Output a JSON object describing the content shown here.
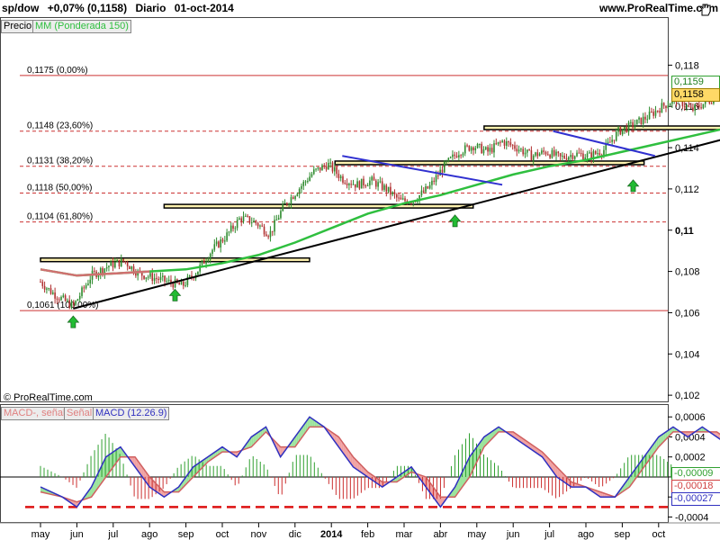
{
  "header": {
    "ticker": "sp/dow",
    "change": "+0,07% (0,1158)",
    "period": "Diario",
    "date": "01-oct-2014",
    "site": "www.ProRealTime.com"
  },
  "price_panel": {
    "tab_label": "Precio",
    "ma_label": "MM (Ponderada 150)",
    "copyright": "© ProRealTime.com",
    "last_price": "0,1158",
    "ma_value": "0,1159"
  },
  "macd_panel": {
    "legend": [
      {
        "text": "MACD-, señal",
        "color": "#e08080"
      },
      {
        "text": "Señal",
        "color": "#e08080"
      },
      {
        "text": "MACD (12.26.9)",
        "color": "#3030c0"
      }
    ],
    "readouts": [
      {
        "text": "-0,00009",
        "color": "#30a030"
      },
      {
        "text": "-0,00018",
        "color": "#d04040"
      },
      {
        "text": "-0,00027",
        "color": "#3030c0"
      }
    ]
  },
  "colors": {
    "up_candle": "#2e8b2e",
    "down_candle": "#b03030",
    "moving_average": "#2fbf3f",
    "trendline": "#000000",
    "channel_line": "#3030d0",
    "fib_line": "#cc3333",
    "zone_fill": "#fff3b0",
    "arrow": "#22bb33"
  },
  "icons": [
    "up-arrow-icon",
    "hand-icon"
  ],
  "chart_data": [
    {
      "type": "line",
      "series": [],
      "x_ticks": [
        "may",
        "jun",
        "jul",
        "ago",
        "sep",
        "oct",
        "nov",
        "dic",
        "2014",
        "feb",
        "mar",
        "abr",
        "may",
        "jun",
        "jul",
        "ago",
        "sep",
        "oct"
      ],
      "y_ticks": [
        "0,102",
        "0,104",
        "0,106",
        "0,108",
        "0,11",
        "0,112",
        "0,114",
        "0,116",
        "0,118"
      ],
      "ylim": [
        0.1017,
        0.1195
      ],
      "fibonacci_levels": [
        {
          "label": "0,1175 (0,00%)",
          "value": 0.1175,
          "style": "solid"
        },
        {
          "label": "0,1148 (23,60%)",
          "value": 0.1148,
          "style": "dashed"
        },
        {
          "label": "0,1131 (38,20%)",
          "value": 0.1131,
          "style": "dashed"
        },
        {
          "label": "0,1118 (50,00%)",
          "value": 0.1118,
          "style": "dashed"
        },
        {
          "label": "0,1104 (61,80%)",
          "value": 0.1104,
          "style": "dashed"
        },
        {
          "label": "0,1061 (100,00%)",
          "value": 0.1061,
          "style": "solid"
        }
      ],
      "price_path": [
        [
          0,
          0.1075
        ],
        [
          0.3,
          0.107
        ],
        [
          0.9,
          0.1063
        ],
        [
          1.4,
          0.1078
        ],
        [
          1.9,
          0.1083
        ],
        [
          2.3,
          0.1085
        ],
        [
          2.7,
          0.1079
        ],
        [
          3.1,
          0.1077
        ],
        [
          3.5,
          0.1075
        ],
        [
          3.9,
          0.1073
        ],
        [
          4.3,
          0.108
        ],
        [
          4.7,
          0.109
        ],
        [
          5.1,
          0.1097
        ],
        [
          5.5,
          0.1106
        ],
        [
          5.9,
          0.1104
        ],
        [
          6.3,
          0.1098
        ],
        [
          6.7,
          0.1112
        ],
        [
          7.1,
          0.112
        ],
        [
          7.5,
          0.1128
        ],
        [
          7.9,
          0.1132
        ],
        [
          8.3,
          0.1125
        ],
        [
          8.7,
          0.1122
        ],
        [
          9.1,
          0.1124
        ],
        [
          9.5,
          0.112
        ],
        [
          9.9,
          0.1114
        ],
        [
          10.3,
          0.1115
        ],
        [
          10.7,
          0.1121
        ],
        [
          11.1,
          0.1131
        ],
        [
          11.5,
          0.1138
        ],
        [
          11.9,
          0.1141
        ],
        [
          12.3,
          0.1138
        ],
        [
          12.7,
          0.1143
        ],
        [
          13.1,
          0.114
        ],
        [
          13.5,
          0.1136
        ],
        [
          13.9,
          0.1138
        ],
        [
          14.3,
          0.1135
        ],
        [
          14.7,
          0.1137
        ],
        [
          15.1,
          0.1136
        ],
        [
          15.5,
          0.1139
        ],
        [
          15.9,
          0.1148
        ],
        [
          16.3,
          0.1151
        ],
        [
          16.7,
          0.1155
        ],
        [
          17.1,
          0.116
        ],
        [
          17.5,
          0.1164
        ],
        [
          17.9,
          0.1158
        ],
        [
          18.3,
          0.1162
        ],
        [
          18.7,
          0.1166
        ],
        [
          19.1,
          0.117
        ],
        [
          19.5,
          0.1174
        ],
        [
          19.9,
          0.1168
        ],
        [
          20.3,
          0.1171
        ],
        [
          20.7,
          0.1176
        ],
        [
          21.1,
          0.1169
        ],
        [
          21.5,
          0.1172
        ],
        [
          21.9,
          0.1166
        ],
        [
          22.3,
          0.1162
        ],
        [
          22.5,
          0.1158
        ]
      ],
      "moving_average": [
        [
          0,
          0.1081
        ],
        [
          1,
          0.1078
        ],
        [
          2,
          0.1079
        ],
        [
          3,
          0.108
        ],
        [
          4,
          0.1081
        ],
        [
          5,
          0.1084
        ],
        [
          6,
          0.1088
        ],
        [
          7,
          0.1094
        ],
        [
          8,
          0.1101
        ],
        [
          9,
          0.1108
        ],
        [
          10,
          0.1113
        ],
        [
          11,
          0.1117
        ],
        [
          12,
          0.1122
        ],
        [
          13,
          0.1127
        ],
        [
          14,
          0.1131
        ],
        [
          15,
          0.1134
        ],
        [
          16,
          0.1138
        ],
        [
          17,
          0.1142
        ],
        [
          18,
          0.1146
        ],
        [
          19,
          0.115
        ],
        [
          20,
          0.1153
        ],
        [
          21,
          0.1157
        ],
        [
          22,
          0.116
        ],
        [
          22.5,
          0.1159
        ]
      ],
      "trendline": [
        [
          0.9,
          0.1062
        ],
        [
          22.9,
          0.1163
        ]
      ],
      "channel_lines": [
        [
          [
            8.3,
            0.1136
          ],
          [
            12.7,
            0.1122
          ]
        ],
        [
          [
            14.1,
            0.1148
          ],
          [
            16.9,
            0.1136
          ]
        ]
      ],
      "zones": [
        {
          "x0": 0,
          "x1": 7.4,
          "y_top": 0.10865,
          "y_bottom": 0.1085
        },
        {
          "x0": 3.4,
          "x1": 11.9,
          "y_top": 0.11125,
          "y_bottom": 0.1111
        },
        {
          "x0": 8.1,
          "x1": 16.6,
          "y_top": 0.11335,
          "y_bottom": 0.1132
        },
        {
          "x0": 12.2,
          "x1": 20.6,
          "y_top": 0.11505,
          "y_bottom": 0.1149
        }
      ],
      "buy_arrows": [
        [
          0.9,
          0.1061
        ],
        [
          3.7,
          0.1074
        ],
        [
          11.4,
          0.111
        ],
        [
          16.3,
          0.1127
        ],
        [
          21.8,
          0.1152
        ]
      ]
    },
    {
      "type": "line",
      "x_ticks": [
        "may",
        "jun",
        "jul",
        "ago",
        "sep",
        "oct",
        "nov",
        "dic",
        "2014",
        "feb",
        "mar",
        "abr",
        "may",
        "jun",
        "jul",
        "ago",
        "sep",
        "oct"
      ],
      "y_ticks": [
        "0,0006",
        "0,0004",
        "0,0002",
        "0",
        "-0,0002",
        "-0,0004"
      ],
      "ylim": [
        -0.00045,
        0.00071
      ],
      "support_level": -0.0003,
      "series": [
        {
          "name": "MACD",
          "values": [
            [
              0,
              -0.0001
            ],
            [
              0.6,
              -0.0002
            ],
            [
              1,
              -0.0003
            ],
            [
              1.4,
              -0.0001
            ],
            [
              1.8,
              0.0002
            ],
            [
              2.2,
              0.0003
            ],
            [
              2.6,
              0.0001
            ],
            [
              3,
              -0.0001
            ],
            [
              3.4,
              -0.0002
            ],
            [
              3.8,
              -0.0001
            ],
            [
              4.2,
              0.0001
            ],
            [
              4.6,
              0.0002
            ],
            [
              5,
              0.0003
            ],
            [
              5.4,
              0.0002
            ],
            [
              5.8,
              0.0004
            ],
            [
              6.2,
              0.0005
            ],
            [
              6.6,
              0.0002
            ],
            [
              7,
              0.0004
            ],
            [
              7.4,
              0.0006
            ],
            [
              7.8,
              0.0005
            ],
            [
              8.2,
              0.0003
            ],
            [
              8.6,
              0.0001
            ],
            [
              9,
              0
            ],
            [
              9.4,
              -0.0001
            ],
            [
              9.8,
              0
            ],
            [
              10.2,
              0.0001
            ],
            [
              10.6,
              -0.0001
            ],
            [
              11,
              -0.0003
            ],
            [
              11.4,
              -0.0001
            ],
            [
              11.8,
              0.0002
            ],
            [
              12.2,
              0.0004
            ],
            [
              12.6,
              0.0005
            ],
            [
              13,
              0.0004
            ],
            [
              13.4,
              0.0003
            ],
            [
              13.8,
              0.0002
            ],
            [
              14.2,
              0
            ],
            [
              14.6,
              -0.0001
            ],
            [
              15,
              -0.0001
            ],
            [
              15.4,
              -0.0002
            ],
            [
              15.8,
              -0.0002
            ],
            [
              16.2,
              0
            ],
            [
              16.6,
              0.0002
            ],
            [
              17,
              0.0004
            ],
            [
              17.4,
              0.0005
            ],
            [
              17.8,
              0.0004
            ],
            [
              18.2,
              0.0005
            ],
            [
              18.6,
              0.0004
            ],
            [
              19,
              0.0003
            ],
            [
              19.4,
              0.0001
            ],
            [
              19.8,
              0.0001
            ],
            [
              20.2,
              0
            ],
            [
              20.6,
              -0.0001
            ],
            [
              21,
              -0.0001
            ],
            [
              21.4,
              -0.0001
            ],
            [
              21.8,
              -0.0002
            ],
            [
              22.3,
              -0.00027
            ]
          ]
        },
        {
          "name": "Señal",
          "values": [
            [
              0,
              -0.00015
            ],
            [
              0.6,
              -0.0002
            ],
            [
              1,
              -0.00025
            ],
            [
              1.4,
              -0.0002
            ],
            [
              1.8,
              0
            ],
            [
              2.2,
              0.0002
            ],
            [
              2.6,
              0.0002
            ],
            [
              3,
              0
            ],
            [
              3.4,
              -0.00015
            ],
            [
              3.8,
              -0.00015
            ],
            [
              4.2,
              0
            ],
            [
              4.6,
              0.00015
            ],
            [
              5,
              0.00025
            ],
            [
              5.4,
              0.00025
            ],
            [
              5.8,
              0.0003
            ],
            [
              6.2,
              0.00045
            ],
            [
              6.6,
              0.0003
            ],
            [
              7,
              0.0003
            ],
            [
              7.4,
              0.0005
            ],
            [
              7.8,
              0.0005
            ],
            [
              8.2,
              0.0004
            ],
            [
              8.6,
              0.0002
            ],
            [
              9,
              5e-05
            ],
            [
              9.4,
              -5e-05
            ],
            [
              9.8,
              -5e-05
            ],
            [
              10.2,
              5e-05
            ],
            [
              10.6,
              0
            ],
            [
              11,
              -0.0002
            ],
            [
              11.4,
              -0.0002
            ],
            [
              11.8,
              0
            ],
            [
              12.2,
              0.0003
            ],
            [
              12.6,
              0.00045
            ],
            [
              13,
              0.00045
            ],
            [
              13.4,
              0.00035
            ],
            [
              13.8,
              0.00025
            ],
            [
              14.2,
              0.0001
            ],
            [
              14.6,
              -5e-05
            ],
            [
              15,
              -0.0001
            ],
            [
              15.4,
              -0.00015
            ],
            [
              15.8,
              -0.0002
            ],
            [
              16.2,
              -0.0001
            ],
            [
              16.6,
              0.0001
            ],
            [
              17,
              0.0003
            ],
            [
              17.4,
              0.00045
            ],
            [
              17.8,
              0.00045
            ],
            [
              18.2,
              0.00045
            ],
            [
              18.6,
              0.00045
            ],
            [
              19,
              0.00035
            ],
            [
              19.4,
              0.0002
            ],
            [
              19.8,
              0.0001
            ],
            [
              20.2,
              5e-05
            ],
            [
              20.6,
              -5e-05
            ],
            [
              21,
              -0.0001
            ],
            [
              21.4,
              -0.0001
            ],
            [
              21.8,
              -0.00015
            ],
            [
              22.3,
              -0.00018
            ]
          ]
        }
      ]
    }
  ]
}
